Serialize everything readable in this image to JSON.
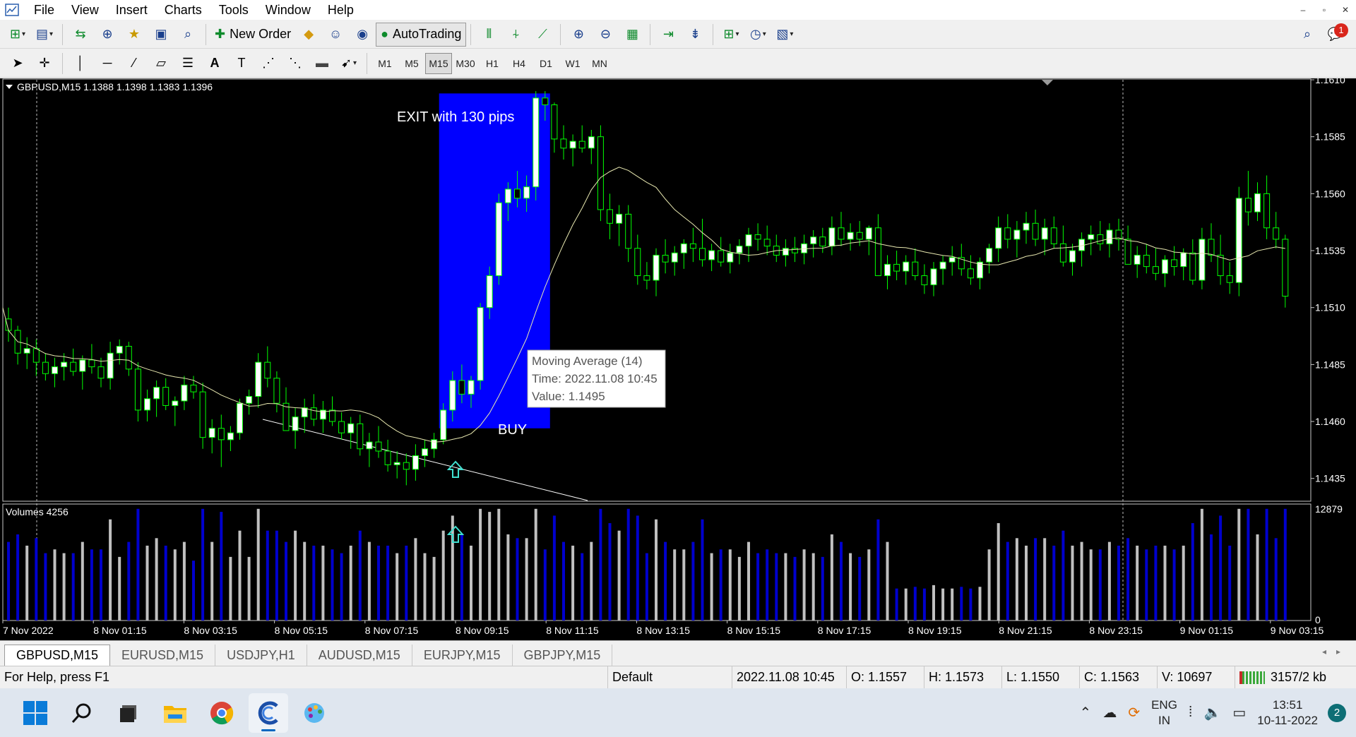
{
  "menu": {
    "items": [
      "File",
      "View",
      "Insert",
      "Charts",
      "Tools",
      "Window",
      "Help"
    ]
  },
  "toolbar": {
    "new_order_label": "New Order",
    "autotrading_label": "AutoTrading",
    "notification_count": "1",
    "timeframes": [
      "M1",
      "M5",
      "M15",
      "M30",
      "H1",
      "H4",
      "D1",
      "W1",
      "MN"
    ],
    "active_timeframe": "M15"
  },
  "chart": {
    "header": "GBPUSD,M15  1.1388 1.1398 1.1383 1.1396",
    "price_labels": [
      "1.1610",
      "1.1585",
      "1.1560",
      "1.1535",
      "1.1510",
      "1.1485",
      "1.1460",
      "1.1435"
    ],
    "volume_label": "Volumes 4256",
    "volume_scale": [
      "12879",
      "0"
    ],
    "time_labels": [
      "7 Nov 2022",
      "8 Nov 01:15",
      "8 Nov 03:15",
      "8 Nov 05:15",
      "8 Nov 07:15",
      "8 Nov 09:15",
      "8 Nov 11:15",
      "8 Nov 13:15",
      "8 Nov 15:15",
      "8 Nov 17:15",
      "8 Nov 19:15",
      "8 Nov 21:15",
      "8 Nov 23:15",
      "9 Nov 01:15",
      "9 Nov 03:15"
    ],
    "exit_annotation": "EXIT with 130 pips",
    "buy_annotation": "BUY",
    "tooltip": {
      "line1": "Moving Average (14)",
      "line2": "Time: 2022.11.08 10:45",
      "line3": "Value: 1.1495"
    },
    "colors": {
      "background": "#000000",
      "bull_candle": "#ffffff",
      "wick": "#00ff00",
      "highlight_box": "#0000ff",
      "volume_up": "#c0c0c0",
      "volume_down": "#0000cd",
      "arrow": "#40e0d0"
    }
  },
  "tabs": [
    {
      "label": "GBPUSD,M15",
      "active": true
    },
    {
      "label": "EURUSD,M15",
      "active": false
    },
    {
      "label": "USDJPY,H1",
      "active": false
    },
    {
      "label": "AUDUSD,M15",
      "active": false
    },
    {
      "label": "EURJPY,M15",
      "active": false
    },
    {
      "label": "GBPJPY,M15",
      "active": false
    }
  ],
  "status": {
    "help": "For Help, press F1",
    "profile": "Default",
    "datetime": "2022.11.08 10:45",
    "open": "O: 1.1557",
    "high": "H: 1.1573",
    "low": "L: 1.1550",
    "close": "C: 1.1563",
    "volume": "V: 10697",
    "traffic": "3157/2 kb"
  },
  "taskbar": {
    "lang_line1": "ENG",
    "lang_line2": "IN",
    "time": "13:51",
    "date": "10-11-2022",
    "notifications": "2"
  },
  "chart_data": {
    "type": "candlestick",
    "symbol": "GBPUSD",
    "timeframe": "M15",
    "ylim": [
      1.1425,
      1.161
    ],
    "y_ticks": [
      1.161,
      1.1585,
      1.156,
      1.1535,
      1.151,
      1.1485,
      1.146,
      1.1435
    ],
    "x_tick_labels": [
      "7 Nov 2022",
      "8 Nov 01:15",
      "8 Nov 03:15",
      "8 Nov 05:15",
      "8 Nov 07:15",
      "8 Nov 09:15",
      "8 Nov 11:15",
      "8 Nov 13:15",
      "8 Nov 15:15",
      "8 Nov 17:15",
      "8 Nov 19:15",
      "8 Nov 21:15",
      "8 Nov 23:15",
      "9 Nov 01:15",
      "9 Nov 03:15"
    ],
    "candles": [
      [
        1.1505,
        1.151,
        1.1495,
        1.15
      ],
      [
        1.15,
        1.1502,
        1.1485,
        1.149
      ],
      [
        1.149,
        1.1497,
        1.1483,
        1.1492
      ],
      [
        1.1492,
        1.1496,
        1.148,
        1.1486
      ],
      [
        1.1486,
        1.149,
        1.1478,
        1.1481
      ],
      [
        1.1481,
        1.1488,
        1.1475,
        1.1484
      ],
      [
        1.1484,
        1.149,
        1.1478,
        1.1486
      ],
      [
        1.1486,
        1.1492,
        1.148,
        1.1482
      ],
      [
        1.1482,
        1.1489,
        1.1474,
        1.1487
      ],
      [
        1.1487,
        1.1494,
        1.1481,
        1.1484
      ],
      [
        1.1484,
        1.1488,
        1.1475,
        1.1479
      ],
      [
        1.1479,
        1.1495,
        1.1474,
        1.149
      ],
      [
        1.149,
        1.1496,
        1.1485,
        1.1493
      ],
      [
        1.1493,
        1.1495,
        1.148,
        1.1483
      ],
      [
        1.1483,
        1.1486,
        1.146,
        1.1465
      ],
      [
        1.1465,
        1.1474,
        1.146,
        1.147
      ],
      [
        1.147,
        1.1478,
        1.1462,
        1.1475
      ],
      [
        1.1475,
        1.1479,
        1.1465,
        1.1467
      ],
      [
        1.1467,
        1.1471,
        1.1458,
        1.1469
      ],
      [
        1.1469,
        1.148,
        1.1465,
        1.1476
      ],
      [
        1.1476,
        1.148,
        1.147,
        1.1473
      ],
      [
        1.1473,
        1.1477,
        1.1448,
        1.1453
      ],
      [
        1.1453,
        1.1461,
        1.1446,
        1.1457
      ],
      [
        1.1457,
        1.1463,
        1.144,
        1.1452
      ],
      [
        1.1452,
        1.1458,
        1.1447,
        1.1455
      ],
      [
        1.1455,
        1.147,
        1.1452,
        1.1468
      ],
      [
        1.1468,
        1.1474,
        1.1463,
        1.1471
      ],
      [
        1.1471,
        1.149,
        1.1466,
        1.1486
      ],
      [
        1.1486,
        1.1493,
        1.1475,
        1.1479
      ],
      [
        1.1479,
        1.1482,
        1.1464,
        1.1468
      ],
      [
        1.1468,
        1.1475,
        1.146,
        1.1456
      ],
      [
        1.1456,
        1.1466,
        1.1448,
        1.1462
      ],
      [
        1.1462,
        1.147,
        1.1455,
        1.1466
      ],
      [
        1.1466,
        1.1472,
        1.1458,
        1.1461
      ],
      [
        1.1461,
        1.1469,
        1.1455,
        1.1465
      ],
      [
        1.1465,
        1.1471,
        1.1458,
        1.146
      ],
      [
        1.146,
        1.1464,
        1.1452,
        1.1455
      ],
      [
        1.1455,
        1.1462,
        1.1448,
        1.1459
      ],
      [
        1.1459,
        1.1463,
        1.1445,
        1.1448
      ],
      [
        1.1448,
        1.1455,
        1.144,
        1.1451
      ],
      [
        1.1451,
        1.1458,
        1.1444,
        1.1447
      ],
      [
        1.1447,
        1.1452,
        1.1438,
        1.1441
      ],
      [
        1.1441,
        1.1447,
        1.1435,
        1.1442
      ],
      [
        1.1442,
        1.1446,
        1.1432,
        1.1439
      ],
      [
        1.1439,
        1.145,
        1.1434,
        1.1445
      ],
      [
        1.1445,
        1.1452,
        1.144,
        1.1448
      ],
      [
        1.1448,
        1.1455,
        1.1444,
        1.1452
      ],
      [
        1.1452,
        1.1468,
        1.145,
        1.1465
      ],
      [
        1.1465,
        1.1482,
        1.146,
        1.1478
      ],
      [
        1.1478,
        1.1485,
        1.1468,
        1.1472
      ],
      [
        1.1472,
        1.148,
        1.1466,
        1.1478
      ],
      [
        1.1478,
        1.1512,
        1.1474,
        1.151
      ],
      [
        1.151,
        1.1528,
        1.1505,
        1.1524
      ],
      [
        1.1524,
        1.156,
        1.152,
        1.1556
      ],
      [
        1.1556,
        1.1565,
        1.1548,
        1.1562
      ],
      [
        1.1562,
        1.157,
        1.1554,
        1.1558
      ],
      [
        1.1558,
        1.1568,
        1.1552,
        1.1563
      ],
      [
        1.1563,
        1.1605,
        1.1557,
        1.1602
      ],
      [
        1.1602,
        1.1605,
        1.1592,
        1.1599
      ],
      [
        1.1599,
        1.16,
        1.1578,
        1.1584
      ],
      [
        1.1584,
        1.159,
        1.1575,
        1.158
      ],
      [
        1.158,
        1.1586,
        1.1572,
        1.1583
      ],
      [
        1.1583,
        1.159,
        1.1578,
        1.158
      ],
      [
        1.158,
        1.1588,
        1.1573,
        1.1585
      ],
      [
        1.1585,
        1.159,
        1.1548,
        1.1553
      ],
      [
        1.1553,
        1.156,
        1.154,
        1.1547
      ],
      [
        1.1547,
        1.1555,
        1.1537,
        1.1551
      ],
      [
        1.1551,
        1.1555,
        1.153,
        1.1536
      ],
      [
        1.1536,
        1.1542,
        1.152,
        1.1524
      ],
      [
        1.1524,
        1.153,
        1.1518,
        1.1522
      ],
      [
        1.1522,
        1.1536,
        1.1515,
        1.1533
      ],
      [
        1.1533,
        1.154,
        1.1525,
        1.153
      ],
      [
        1.153,
        1.1537,
        1.1524,
        1.1534
      ],
      [
        1.1534,
        1.154,
        1.1527,
        1.1538
      ],
      [
        1.1538,
        1.1545,
        1.153,
        1.1536
      ],
      [
        1.1536,
        1.1549,
        1.1528,
        1.1531
      ],
      [
        1.1531,
        1.1538,
        1.1526,
        1.1535
      ],
      [
        1.1535,
        1.1541,
        1.1528,
        1.153
      ],
      [
        1.153,
        1.1538,
        1.1525,
        1.1534
      ],
      [
        1.1534,
        1.154,
        1.1529,
        1.1537
      ],
      [
        1.1537,
        1.1545,
        1.153,
        1.1542
      ],
      [
        1.1542,
        1.1547,
        1.1535,
        1.154
      ],
      [
        1.154,
        1.1546,
        1.1533,
        1.1537
      ],
      [
        1.1537,
        1.1542,
        1.153,
        1.1533
      ],
      [
        1.1533,
        1.154,
        1.1528,
        1.1536
      ],
      [
        1.1536,
        1.1541,
        1.153,
        1.1534
      ],
      [
        1.1534,
        1.1542,
        1.1529,
        1.1538
      ],
      [
        1.1538,
        1.1544,
        1.1532,
        1.1541
      ],
      [
        1.1541,
        1.1545,
        1.1534,
        1.1537
      ],
      [
        1.1537,
        1.155,
        1.1533,
        1.1545
      ],
      [
        1.1545,
        1.1552,
        1.1537,
        1.154
      ],
      [
        1.154,
        1.1547,
        1.1535,
        1.1543
      ],
      [
        1.1543,
        1.1548,
        1.1537,
        1.154
      ],
      [
        1.154,
        1.1546,
        1.1533,
        1.1545
      ],
      [
        1.1545,
        1.1551,
        1.153,
        1.1524
      ],
      [
        1.1524,
        1.1533,
        1.1518,
        1.1529
      ],
      [
        1.1529,
        1.1535,
        1.1522,
        1.1526
      ],
      [
        1.1526,
        1.1533,
        1.152,
        1.153
      ],
      [
        1.153,
        1.1536,
        1.1522,
        1.1524
      ],
      [
        1.1524,
        1.1529,
        1.1516,
        1.152
      ],
      [
        1.152,
        1.153,
        1.1515,
        1.1527
      ],
      [
        1.1527,
        1.1533,
        1.152,
        1.153
      ],
      [
        1.153,
        1.1537,
        1.1524,
        1.1532
      ],
      [
        1.1532,
        1.1538,
        1.1524,
        1.1527
      ],
      [
        1.1527,
        1.1533,
        1.152,
        1.1523
      ],
      [
        1.1523,
        1.1532,
        1.1518,
        1.153
      ],
      [
        1.153,
        1.1538,
        1.1525,
        1.1536
      ],
      [
        1.1536,
        1.155,
        1.153,
        1.1545
      ],
      [
        1.1545,
        1.1551,
        1.1536,
        1.154
      ],
      [
        1.154,
        1.1548,
        1.1532,
        1.1544
      ],
      [
        1.1544,
        1.1552,
        1.1538,
        1.1547
      ],
      [
        1.1547,
        1.1553,
        1.1537,
        1.154
      ],
      [
        1.154,
        1.1549,
        1.1533,
        1.1545
      ],
      [
        1.1545,
        1.155,
        1.1536,
        1.1538
      ],
      [
        1.1538,
        1.1546,
        1.1528,
        1.153
      ],
      [
        1.153,
        1.1538,
        1.1524,
        1.1535
      ],
      [
        1.1535,
        1.1543,
        1.1528,
        1.154
      ],
      [
        1.154,
        1.1546,
        1.1533,
        1.1542
      ],
      [
        1.1542,
        1.1548,
        1.1535,
        1.1538
      ],
      [
        1.1538,
        1.1547,
        1.1532,
        1.1544
      ],
      [
        1.1544,
        1.1549,
        1.1535,
        1.154
      ],
      [
        1.154,
        1.1546,
        1.153,
        1.1529
      ],
      [
        1.1529,
        1.1537,
        1.1523,
        1.1533
      ],
      [
        1.1533,
        1.1538,
        1.1525,
        1.1528
      ],
      [
        1.1528,
        1.1536,
        1.1522,
        1.1525
      ],
      [
        1.1525,
        1.1533,
        1.1519,
        1.1531
      ],
      [
        1.1531,
        1.1537,
        1.1524,
        1.1528
      ],
      [
        1.1528,
        1.1536,
        1.1522,
        1.1534
      ],
      [
        1.1534,
        1.154,
        1.152,
        1.1522
      ],
      [
        1.1522,
        1.1545,
        1.1518,
        1.154
      ],
      [
        1.154,
        1.1547,
        1.153,
        1.1533
      ],
      [
        1.1533,
        1.1542,
        1.152,
        1.1524
      ],
      [
        1.1524,
        1.153,
        1.1516,
        1.1521
      ],
      [
        1.1521,
        1.1563,
        1.1515,
        1.1558
      ],
      [
        1.1558,
        1.157,
        1.1546,
        1.1552
      ],
      [
        1.1552,
        1.1565,
        1.1548,
        1.156
      ],
      [
        1.156,
        1.1568,
        1.154,
        1.1545
      ],
      [
        1.1545,
        1.1552,
        1.1536,
        1.154
      ],
      [
        1.154,
        1.1542,
        1.151,
        1.1515
      ]
    ],
    "moving_average_period": 14,
    "volume_ylim": [
      0,
      12879
    ]
  }
}
